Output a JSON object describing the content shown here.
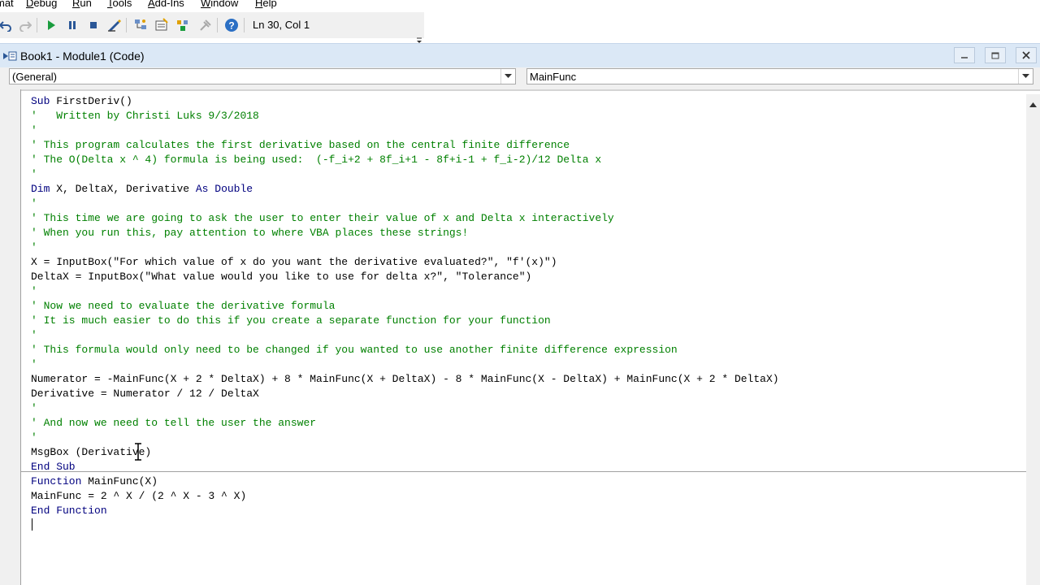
{
  "menu": {
    "items": [
      {
        "label": "mat",
        "hotkey_index": -1
      },
      {
        "label": "Debug",
        "hotkey_index": 0
      },
      {
        "label": "Run",
        "hotkey_index": 0
      },
      {
        "label": "Tools",
        "hotkey_index": 0
      },
      {
        "label": "Add-Ins",
        "hotkey_index": 0
      },
      {
        "label": "Window",
        "hotkey_index": 0
      },
      {
        "label": "Help",
        "hotkey_index": 0
      }
    ]
  },
  "toolbar": {
    "buttons": [
      "undo-icon",
      "redo-icon",
      "run-icon",
      "break-icon",
      "reset-icon",
      "design-mode-icon",
      "project-explorer-icon",
      "properties-window-icon",
      "object-browser-icon",
      "toolbox-icon",
      "help-icon"
    ],
    "status": "Ln 30, Col 1"
  },
  "window": {
    "title": "Book1 - Module1 (Code)"
  },
  "combos": {
    "object": "(General)",
    "procedure": "MainFunc"
  },
  "code": {
    "lines": [
      [
        {
          "t": "Sub ",
          "c": "kw"
        },
        {
          "t": "FirstDeriv()",
          "c": ""
        }
      ],
      [
        {
          "t": "'   Written by Christi Luks 9/3/2018",
          "c": "cm"
        }
      ],
      [
        {
          "t": "'",
          "c": "cm"
        }
      ],
      [
        {
          "t": "' This program calculates the first derivative based on the central finite difference",
          "c": "cm"
        }
      ],
      [
        {
          "t": "' The O(Delta x ^ 4) formula is being used:  (-f_i+2 + 8f_i+1 - 8f+i-1 + f_i-2)/12 Delta x",
          "c": "cm"
        }
      ],
      [
        {
          "t": "'",
          "c": "cm"
        }
      ],
      [
        {
          "t": "Dim ",
          "c": "kw"
        },
        {
          "t": "X, DeltaX, Derivative ",
          "c": ""
        },
        {
          "t": "As Double",
          "c": "kw"
        }
      ],
      [
        {
          "t": "'",
          "c": "cm"
        }
      ],
      [
        {
          "t": "' This time we are going to ask the user to enter their value of x and Delta x interactively",
          "c": "cm"
        }
      ],
      [
        {
          "t": "' When you run this, pay attention to where VBA places these strings!",
          "c": "cm"
        }
      ],
      [
        {
          "t": "'",
          "c": "cm"
        }
      ],
      [
        {
          "t": "X = InputBox(\"For which value of x do you want the derivative evaluated?\", \"f'(x)\")",
          "c": ""
        }
      ],
      [
        {
          "t": "DeltaX = InputBox(\"What value would you like to use for delta x?\", \"Tolerance\")",
          "c": ""
        }
      ],
      [
        {
          "t": "'",
          "c": "cm"
        }
      ],
      [
        {
          "t": "' Now we need to evaluate the derivative formula",
          "c": "cm"
        }
      ],
      [
        {
          "t": "' It is much easier to do this if you create a separate function for your function",
          "c": "cm"
        }
      ],
      [
        {
          "t": "'",
          "c": "cm"
        }
      ],
      [
        {
          "t": "' This formula would only need to be changed if you wanted to use another finite difference expression",
          "c": "cm"
        }
      ],
      [
        {
          "t": "'",
          "c": "cm"
        }
      ],
      [
        {
          "t": "Numerator = -MainFunc(X + 2 * DeltaX) + 8 * MainFunc(X + DeltaX) - 8 * MainFunc(X - DeltaX) + MainFunc(X + 2 * DeltaX)",
          "c": ""
        }
      ],
      [
        {
          "t": "Derivative = Numerator / 12 / DeltaX",
          "c": ""
        }
      ],
      [
        {
          "t": "'",
          "c": "cm"
        }
      ],
      [
        {
          "t": "' And now we need to tell the user the answer",
          "c": "cm"
        }
      ],
      [
        {
          "t": "'",
          "c": "cm"
        }
      ],
      [
        {
          "t": "MsgBox (Derivative)",
          "c": ""
        }
      ],
      [
        {
          "t": "End Sub",
          "c": "kw"
        }
      ],
      [
        {
          "t": "Function ",
          "c": "kw"
        },
        {
          "t": "MainFunc(X)",
          "c": ""
        }
      ],
      [
        {
          "t": "MainFunc = 2 ^ X / (2 ^ X - 3 ^ X)",
          "c": ""
        }
      ],
      [
        {
          "t": "End Function",
          "c": "kw"
        }
      ],
      [
        {
          "t": "",
          "c": ""
        }
      ]
    ]
  },
  "colors": {
    "keyword": "#00007f",
    "comment": "#008000",
    "titlebar": "#dbe8f6"
  }
}
